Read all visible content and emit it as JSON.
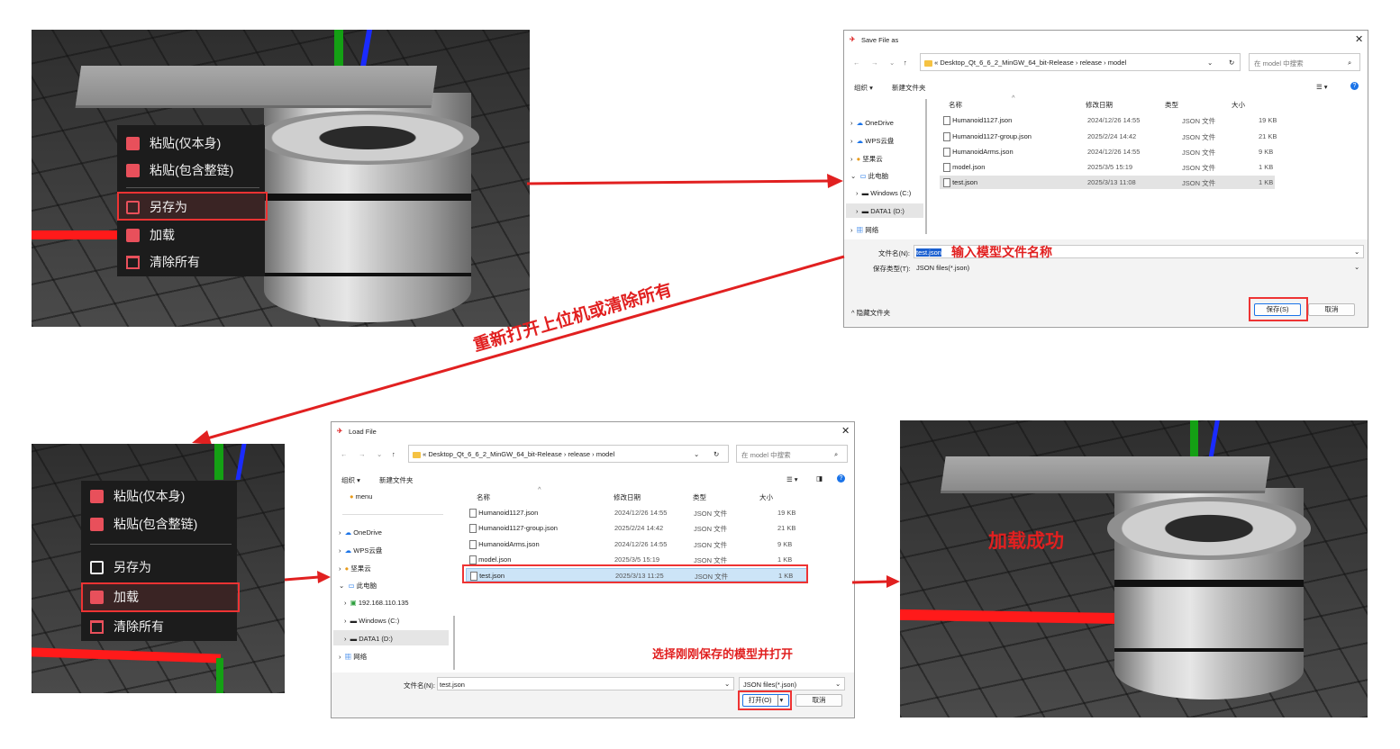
{
  "context_menu_1": {
    "items": [
      "粘贴(仅本身)",
      "粘贴(包含整链)",
      "另存为",
      "加载",
      "清除所有"
    ]
  },
  "context_menu_2": {
    "items": [
      "粘贴(仅本身)",
      "粘贴(包含整链)",
      "另存为",
      "加载",
      "清除所有"
    ]
  },
  "save_dialog": {
    "title": "Save File as",
    "path": [
      "Desktop_Qt_6_6_2_MinGW_64_bit-Release",
      "release",
      "model"
    ],
    "path_prefix": "«",
    "search_placeholder": "在 model 中搜索",
    "toolbar": {
      "organize": "组织 ▾",
      "new_folder": "新建文件夹",
      "view": "☰ ▾"
    },
    "nav": [
      "OneDrive",
      "WPS云盘",
      "坚果云",
      "此电脑",
      "Windows (C:)",
      "DATA1 (D:)",
      "网络"
    ],
    "columns": [
      "名称",
      "修改日期",
      "类型",
      "大小"
    ],
    "files": [
      {
        "name": "Humanoid1127.json",
        "date": "2024/12/26 14:55",
        "type": "JSON 文件",
        "size": "19 KB"
      },
      {
        "name": "Humanoid1127-group.json",
        "date": "2025/2/24 14:42",
        "type": "JSON 文件",
        "size": "21 KB"
      },
      {
        "name": "HumanoidArms.json",
        "date": "2024/12/26 14:55",
        "type": "JSON 文件",
        "size": "9 KB"
      },
      {
        "name": "model.json",
        "date": "2025/3/5 15:19",
        "type": "JSON 文件",
        "size": "1 KB"
      },
      {
        "name": "test.json",
        "date": "2025/3/13 11:08",
        "type": "JSON 文件",
        "size": "1 KB"
      }
    ],
    "filename_label": "文件名(N):",
    "filename_value": "test.json",
    "filetype_label": "保存类型(T):",
    "filetype_value": "JSON files(*.json)",
    "hide_folders": "隐藏文件夹",
    "save_button": "保存(S)",
    "cancel_button": "取消"
  },
  "load_dialog": {
    "title": "Load File",
    "path": [
      "Desktop_Qt_6_6_2_MinGW_64_bit-Release",
      "release",
      "model"
    ],
    "path_prefix": "«",
    "search_placeholder": "在 model 中搜索",
    "toolbar": {
      "organize": "组织 ▾",
      "new_folder": "新建文件夹",
      "view": "☰ ▾"
    },
    "nav": [
      "menu",
      "OneDrive",
      "WPS云盘",
      "坚果云",
      "此电脑",
      "192.168.110.135",
      "Windows (C:)",
      "DATA1 (D:)",
      "网络"
    ],
    "columns": [
      "名称",
      "修改日期",
      "类型",
      "大小"
    ],
    "files": [
      {
        "name": "Humanoid1127.json",
        "date": "2024/12/26 14:55",
        "type": "JSON 文件",
        "size": "19 KB"
      },
      {
        "name": "Humanoid1127-group.json",
        "date": "2025/2/24 14:42",
        "type": "JSON 文件",
        "size": "21 KB"
      },
      {
        "name": "HumanoidArms.json",
        "date": "2024/12/26 14:55",
        "type": "JSON 文件",
        "size": "9 KB"
      },
      {
        "name": "model.json",
        "date": "2025/3/5 15:19",
        "type": "JSON 文件",
        "size": "1 KB"
      },
      {
        "name": "test.json",
        "date": "2025/3/13 11:25",
        "type": "JSON 文件",
        "size": "1 KB"
      }
    ],
    "filename_label": "文件名(N):",
    "filename_value": "test.json",
    "filetype_value": "JSON files(*.json)",
    "open_button": "打开(O)",
    "cancel_button": "取消"
  },
  "annotations": {
    "input_name": "输入模型文件名称",
    "reopen": "重新打开上位机或清除所有",
    "select_open": "选择刚刚保存的模型并打开",
    "load_success": "加载成功"
  },
  "colors": {
    "annotation_red": "#e12020",
    "menu_icon_red": "#e8505b",
    "axis_red": "#ff1a1a",
    "axis_green": "#14a014",
    "axis_blue": "#1a2bff"
  }
}
